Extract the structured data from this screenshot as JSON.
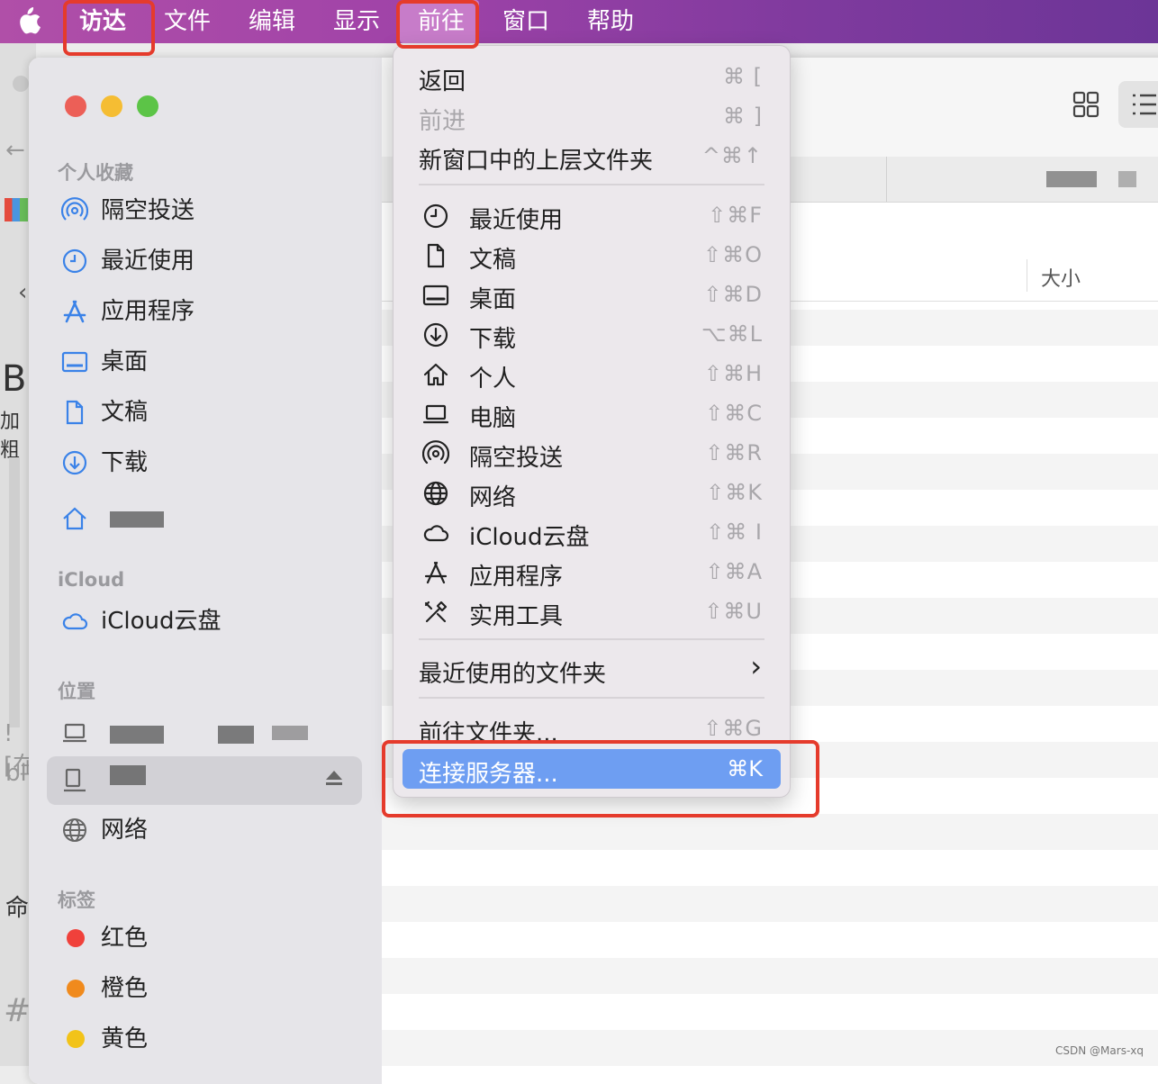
{
  "menubar": {
    "items": [
      "访达",
      "文件",
      "编辑",
      "显示",
      "前往",
      "窗口",
      "帮助"
    ],
    "active": "前往"
  },
  "background_app": {
    "bold_glyph": "B",
    "bold_caption": "加粗",
    "snippet_1": "![在",
    "snippet_2": "bl",
    "snippet_3": "命",
    "snippet_4": "#"
  },
  "sidebar": {
    "favorites_title": "个人收藏",
    "favorites": [
      {
        "label": "隔空投送",
        "icon": "airdrop-icon"
      },
      {
        "label": "最近使用",
        "icon": "clock-icon"
      },
      {
        "label": "应用程序",
        "icon": "apps-icon"
      },
      {
        "label": "桌面",
        "icon": "desktop-icon"
      },
      {
        "label": "文稿",
        "icon": "document-icon"
      },
      {
        "label": "下载",
        "icon": "download-icon"
      }
    ],
    "icloud_title": "iCloud",
    "icloud_item": "iCloud云盘",
    "locations_title": "位置",
    "network_item": "网络",
    "tags_title": "标签",
    "tags": [
      {
        "label": "红色",
        "color": "#f0413b"
      },
      {
        "label": "橙色",
        "color": "#f08a1d"
      },
      {
        "label": "黄色",
        "color": "#f2c319"
      }
    ]
  },
  "content": {
    "size_column": "大小"
  },
  "go_menu": {
    "back": {
      "label": "返回",
      "shortcut": "⌘ ["
    },
    "forward": {
      "label": "前进",
      "shortcut": "⌘ ]"
    },
    "enclosing": {
      "label": "新窗口中的上层文件夹",
      "shortcut": "^⌘↑"
    },
    "places": [
      {
        "label": "最近使用",
        "shortcut": "⇧⌘F",
        "icon": "clock-icon"
      },
      {
        "label": "文稿",
        "shortcut": "⇧⌘O",
        "icon": "document-icon"
      },
      {
        "label": "桌面",
        "shortcut": "⇧⌘D",
        "icon": "desktop-icon"
      },
      {
        "label": "下载",
        "shortcut": "⌥⌘L",
        "icon": "download-icon"
      },
      {
        "label": "个人",
        "shortcut": "⇧⌘H",
        "icon": "home-icon"
      },
      {
        "label": "电脑",
        "shortcut": "⇧⌘C",
        "icon": "laptop-icon"
      },
      {
        "label": "隔空投送",
        "shortcut": "⇧⌘R",
        "icon": "airdrop-icon"
      },
      {
        "label": "网络",
        "shortcut": "⇧⌘K",
        "icon": "globe-icon"
      },
      {
        "label": "iCloud云盘",
        "shortcut": "⇧⌘ I",
        "icon": "cloud-icon"
      },
      {
        "label": "应用程序",
        "shortcut": "⇧⌘A",
        "icon": "apps-icon"
      },
      {
        "label": "实用工具",
        "shortcut": "⇧⌘U",
        "icon": "tools-icon"
      }
    ],
    "recent_folders": {
      "label": "最近使用的文件夹",
      "arrow": "›"
    },
    "goto_folder": {
      "label": "前往文件夹...",
      "shortcut": "⇧⌘G"
    },
    "connect_server": {
      "label": "连接服务器...",
      "shortcut": "⌘K"
    }
  },
  "watermark": "CSDN @Mars-xq"
}
